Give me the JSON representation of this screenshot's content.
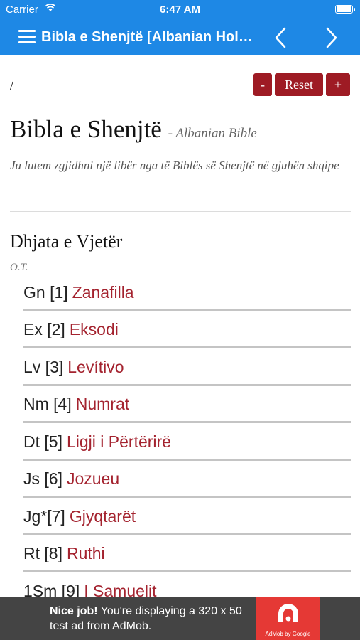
{
  "status_bar": {
    "carrier": "Carrier",
    "time": "6:47 AM",
    "battery_level": 1.0
  },
  "nav": {
    "title": "Bibla e Shenjtë [Albanian Holy Bible]",
    "menu_icon": "hamburger-menu-icon",
    "prev_icon": "chevron-left-icon",
    "next_icon": "chevron-right-icon"
  },
  "toolbar": {
    "breadcrumb": "/",
    "zoom_out_label": "-",
    "reset_label": "Reset",
    "zoom_in_label": "+"
  },
  "page": {
    "title": "Bibla e Shenjtë",
    "subtitle": "- Albanian Bible",
    "intro": "Ju lutem zgjidhni një libër nga të Biblës së Shenjtë në gjuhën shqipe"
  },
  "section": {
    "title": "Dhjata e Vjetër",
    "abbr": "O.T."
  },
  "books": [
    {
      "prefix": "Gn [1]",
      "name": "Zanafilla"
    },
    {
      "prefix": "Ex [2]",
      "name": "Eksodi"
    },
    {
      "prefix": "Lv [3]",
      "name": "Levítivo"
    },
    {
      "prefix": "Nm [4]",
      "name": "Numrat"
    },
    {
      "prefix": "Dt [5]",
      "name": "Ligji i Përtërirë"
    },
    {
      "prefix": "Js [6]",
      "name": "Jozueu"
    },
    {
      "prefix": "Jg*[7]",
      "name": "Gjyqtarët"
    },
    {
      "prefix": "Rt [8]",
      "name": "Ruthi"
    },
    {
      "prefix": "1Sm [9]",
      "name": "I Samuelit"
    }
  ],
  "ad": {
    "headline": "Nice job!",
    "body": "You're displaying a 320 x 50 test ad from AdMob.",
    "logo_caption": "AdMob by Google"
  },
  "colors": {
    "accent": "#1e88e5",
    "button": "#9e1b24",
    "book_link": "#a4232f",
    "ad_background": "#444444",
    "ad_logo": "#e53935"
  }
}
